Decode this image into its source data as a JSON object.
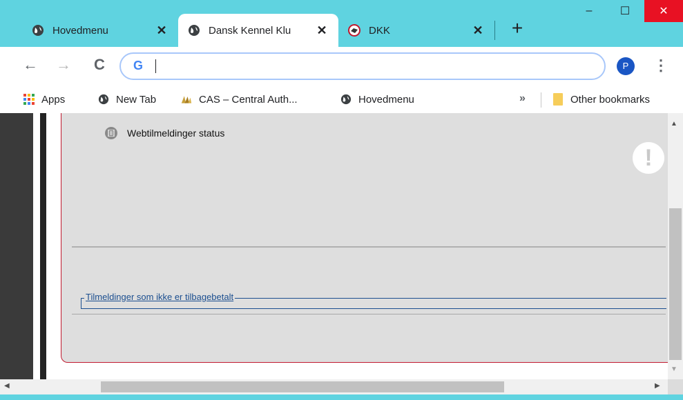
{
  "tabs": [
    {
      "title": "Hovedmenu",
      "favicon": "globe-icon",
      "active": false
    },
    {
      "title": "Dansk Kennel Klu",
      "favicon": "globe-icon",
      "active": true
    },
    {
      "title": "DKK",
      "favicon": "dkk-logo-icon",
      "active": false
    }
  ],
  "tab_close_glyph": "✕",
  "new_tab_glyph": "+",
  "window_controls": {
    "minimize": "–",
    "maximize": "☐",
    "close": "✕"
  },
  "toolbar": {
    "back": "←",
    "forward": "→",
    "reload": "C",
    "address_value": "",
    "google_logo": "G",
    "profile_initial": "P",
    "menu": "⋮"
  },
  "bookmarks": [
    {
      "label": "Apps",
      "icon": "apps-grid-icon"
    },
    {
      "label": "New Tab",
      "icon": "globe-icon"
    },
    {
      "label": "CAS – Central Auth...",
      "icon": "cas-logo-icon"
    },
    {
      "label": "Hovedmenu",
      "icon": "globe-icon"
    }
  ],
  "bookmarks_overflow": "»",
  "other_bookmarks": {
    "label": "Other bookmarks",
    "icon": "folder-icon"
  },
  "page": {
    "status_item": "Webtilmeldinger status",
    "alert_glyph": "!",
    "fieldset_legend": "Tilmeldinger som ikke er tilbagebetalt"
  },
  "scrollbars": {
    "up": "▲",
    "down": "▼",
    "left": "◀",
    "right": "▶"
  },
  "colors": {
    "titlebar": "#5fd3e0",
    "close_button": "#e81123",
    "panel_border": "#c0182d",
    "link": "#1b4e8f",
    "profile": "#1a56c4"
  }
}
